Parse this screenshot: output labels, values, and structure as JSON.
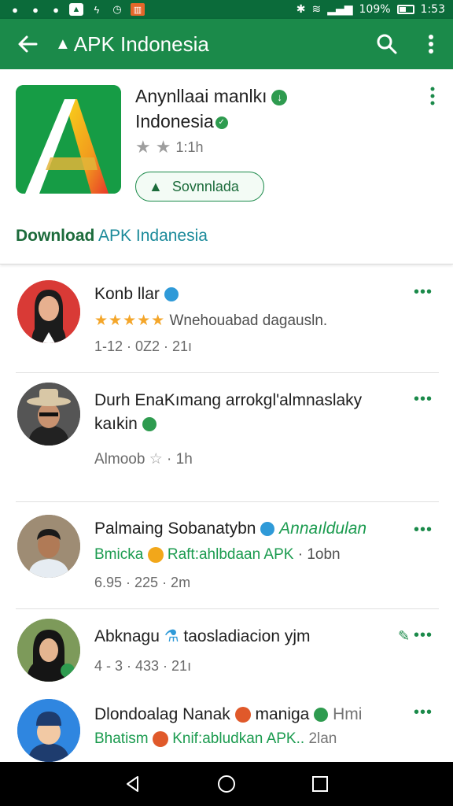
{
  "status_bar": {
    "battery": "109%",
    "time": "1:53"
  },
  "app_bar": {
    "title": "APK Indonesia"
  },
  "app": {
    "name_line1": "Anynllaai manlkı",
    "name_line2": "Indonesia",
    "rating": "1:1h",
    "install_label": "Sovnnlada",
    "download_bold": "Download",
    "download_link": "APK Indanesia"
  },
  "reviews": [
    {
      "name": "Konb llar",
      "stars": "★★★★★",
      "text": "Wnehouabad dagausln.",
      "sub": "1-12 · 0Z2 · 21ı"
    },
    {
      "name": "Durh EnaKımang arrokgl'almnaslaky",
      "name2": "kaıkin",
      "sub": "Almoob",
      "sub_tail": "· 1h"
    },
    {
      "name": "Palmaing Sobanatybn",
      "name_tail": "Annaıldulan",
      "line2_a": "Bmicka",
      "line2_b": "Raft:ahlbdaan APK",
      "line2_c": "· 1obn",
      "sub": "6.95 · 225 · 2m"
    },
    {
      "name": "Abknagu",
      "name_tail": "taosladiacion yjm",
      "sub": "4 - 3 · 433 · 21ı"
    },
    {
      "name": "Dlondoalag Nanak",
      "name_mid": "maniga",
      "name_tail": "Hmi",
      "line2_a": "Bhatism",
      "line2_b": "Knif:abludkan APK..",
      "line2_c": "2lan"
    }
  ]
}
